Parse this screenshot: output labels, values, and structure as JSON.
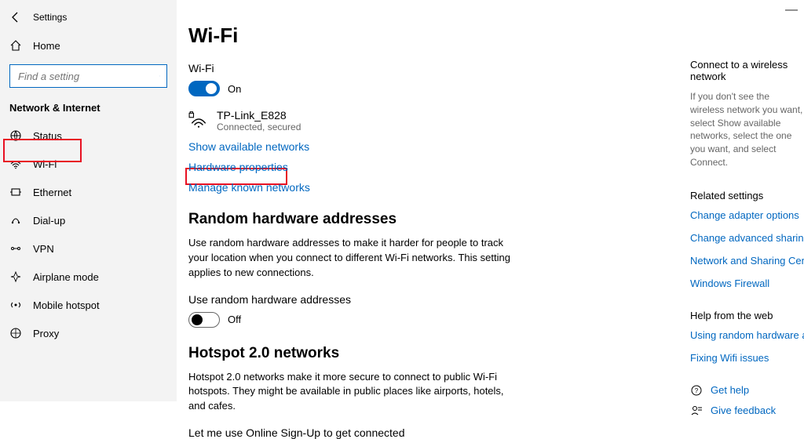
{
  "window": {
    "minimize": "—"
  },
  "header": {
    "settings": "Settings",
    "home": "Home"
  },
  "search": {
    "placeholder": "Find a setting"
  },
  "nav": {
    "section": "Network & Internet",
    "items": [
      {
        "label": "Status"
      },
      {
        "label": "Wi-Fi"
      },
      {
        "label": "Ethernet"
      },
      {
        "label": "Dial-up"
      },
      {
        "label": "VPN"
      },
      {
        "label": "Airplane mode"
      },
      {
        "label": "Mobile hotspot"
      },
      {
        "label": "Proxy"
      }
    ]
  },
  "main": {
    "title": "Wi-Fi",
    "wifi_label": "Wi-Fi",
    "wifi_state": "On",
    "network": {
      "name": "TP-Link_E828",
      "status": "Connected, secured"
    },
    "links": {
      "show_available": "Show available networks",
      "hardware_props": "Hardware properties",
      "manage_known": "Manage known networks"
    },
    "random": {
      "heading": "Random hardware addresses",
      "desc": "Use random hardware addresses to make it harder for people to track your location when you connect to different Wi-Fi networks. This setting applies to new connections.",
      "toggle_label": "Use random hardware addresses",
      "toggle_state": "Off"
    },
    "hotspot": {
      "heading": "Hotspot 2.0 networks",
      "desc": "Hotspot 2.0 networks make it more secure to connect to public Wi-Fi hotspots. They might be available in public places like airports, hotels, and cafes.",
      "signup": "Let me use Online Sign-Up to get connected"
    }
  },
  "right": {
    "connect_h": "Connect to a wireless network",
    "connect_txt": "If you don't see the wireless network you want, select Show available networks, select the one you want, and select Connect.",
    "related_h": "Related settings",
    "related": {
      "adapter": "Change adapter options",
      "sharing": "Change advanced sharing options",
      "center": "Network and Sharing Center",
      "firewall": "Windows Firewall"
    },
    "help_h": "Help from the web",
    "help": {
      "random": "Using random hardware addresses",
      "wifi": "Fixing Wifi issues"
    },
    "get_help": "Get help",
    "feedback": "Give feedback"
  }
}
